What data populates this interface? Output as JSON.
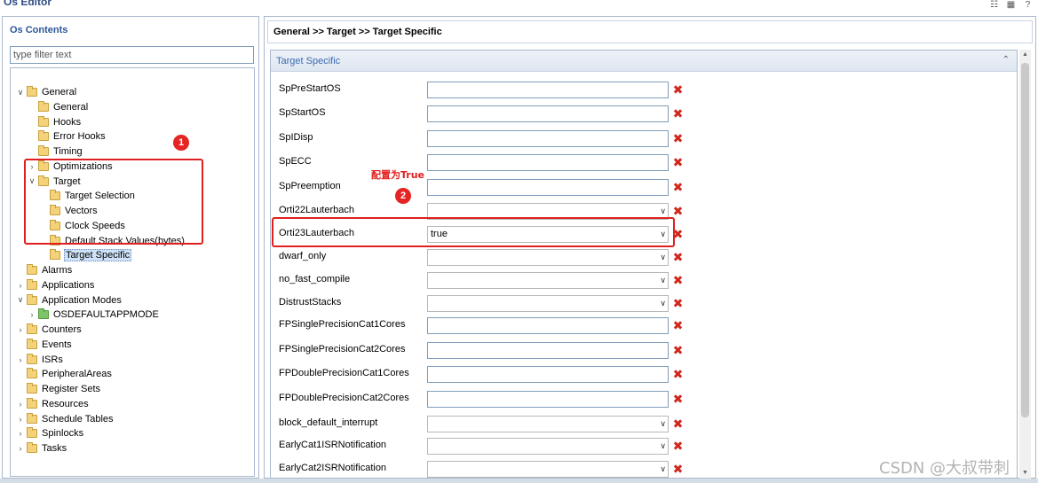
{
  "app": {
    "title": "Os Editor"
  },
  "left": {
    "header": "Os Contents",
    "filter_placeholder": "type filter text",
    "tree": [
      {
        "label": "General",
        "toggle": "open"
      },
      {
        "label": "General",
        "toggle": "none"
      },
      {
        "label": "Hooks",
        "toggle": "none"
      },
      {
        "label": "Error Hooks",
        "toggle": "none"
      },
      {
        "label": "Timing",
        "toggle": "none"
      },
      {
        "label": "Optimizations",
        "toggle": "closed"
      },
      {
        "label": "Target",
        "toggle": "open"
      },
      {
        "label": "Target Selection",
        "toggle": "none"
      },
      {
        "label": "Vectors",
        "toggle": "none"
      },
      {
        "label": "Clock Speeds",
        "toggle": "none"
      },
      {
        "label": "Default Stack Values(bytes)",
        "toggle": "none"
      },
      {
        "label": "Target Specific",
        "toggle": "none",
        "selected": true
      },
      {
        "label": "Alarms",
        "toggle": "none"
      },
      {
        "label": "Applications",
        "toggle": "closed"
      },
      {
        "label": "Application Modes",
        "toggle": "open"
      },
      {
        "label": "OSDEFAULTAPPMODE",
        "toggle": "closed"
      },
      {
        "label": "Counters",
        "toggle": "closed"
      },
      {
        "label": "Events",
        "toggle": "none"
      },
      {
        "label": "ISRs",
        "toggle": "closed"
      },
      {
        "label": "PeripheralAreas",
        "toggle": "none"
      },
      {
        "label": "Register Sets",
        "toggle": "none"
      },
      {
        "label": "Resources",
        "toggle": "closed"
      },
      {
        "label": "Schedule Tables",
        "toggle": "closed"
      },
      {
        "label": "Spinlocks",
        "toggle": "closed"
      },
      {
        "label": "Tasks",
        "toggle": "closed"
      }
    ]
  },
  "right": {
    "breadcrumb": "General >> Target >> Target Specific",
    "section_title": "Target Specific",
    "properties": [
      {
        "label": "SpPreStartOS",
        "type": "text",
        "value": ""
      },
      {
        "label": "SpStartOS",
        "type": "text",
        "value": ""
      },
      {
        "label": "SpIDisp",
        "type": "text",
        "value": ""
      },
      {
        "label": "SpECC",
        "type": "text",
        "value": ""
      },
      {
        "label": "SpPreemption",
        "type": "text",
        "value": ""
      },
      {
        "label": "Orti22Lauterbach",
        "type": "select",
        "value": ""
      },
      {
        "label": "Orti23Lauterbach",
        "type": "select",
        "value": "true"
      },
      {
        "label": "dwarf_only",
        "type": "select",
        "value": ""
      },
      {
        "label": "no_fast_compile",
        "type": "select",
        "value": ""
      },
      {
        "label": "DistrustStacks",
        "type": "select",
        "value": ""
      },
      {
        "label": "FPSinglePrecisionCat1Cores",
        "type": "text",
        "value": ""
      },
      {
        "label": "FPSinglePrecisionCat2Cores",
        "type": "text",
        "value": ""
      },
      {
        "label": "FPDoublePrecisionCat1Cores",
        "type": "text",
        "value": ""
      },
      {
        "label": "FPDoublePrecisionCat2Cores",
        "type": "text",
        "value": ""
      },
      {
        "label": "block_default_interrupt",
        "type": "select",
        "value": ""
      },
      {
        "label": "EarlyCat1ISRNotification",
        "type": "select",
        "value": ""
      },
      {
        "label": "EarlyCat2ISRNotification",
        "type": "select",
        "value": ""
      }
    ]
  },
  "annotations": {
    "circle1": "1",
    "circle2": "2",
    "note": "配置为True",
    "color": "#e02020"
  },
  "watermark": "CSDN @大叔带刺"
}
